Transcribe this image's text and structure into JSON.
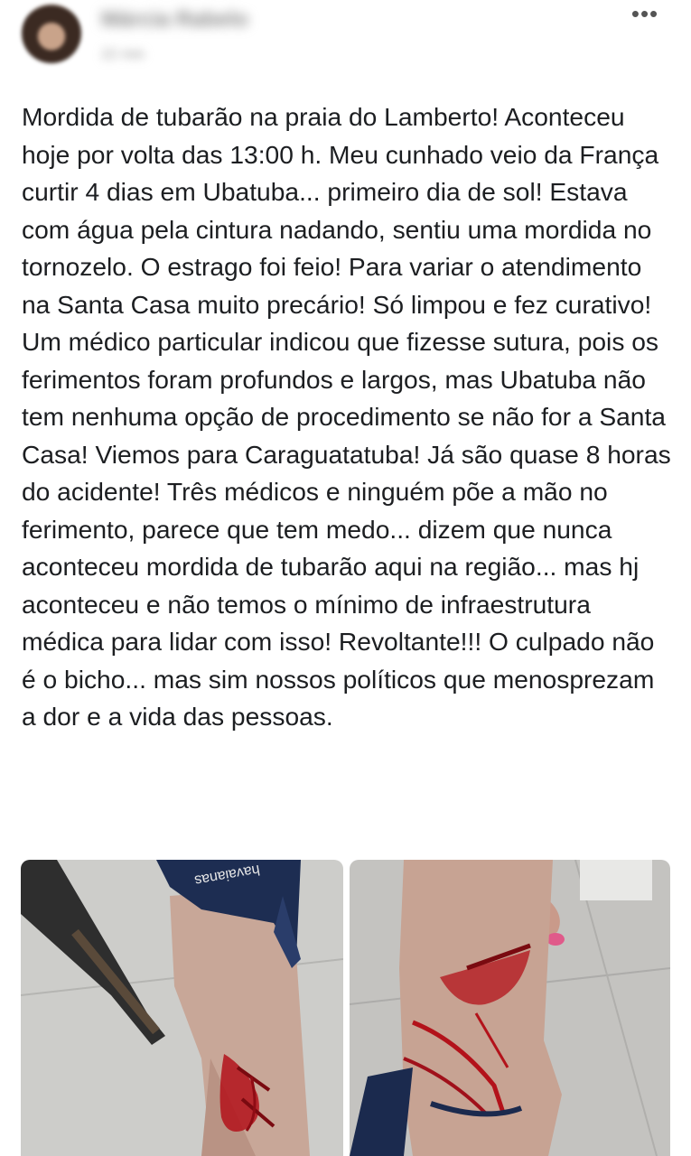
{
  "header": {
    "author_name": "Márcia Rabelo",
    "time": "22 min",
    "more_icon": "ellipsis-icon",
    "more_glyph": "•••"
  },
  "post": {
    "text": "Mordida de tubarão na praia do Lamberto! Aconteceu hoje por volta das 13:00 h. Meu cunhado veio da França curtir 4 dias em Ubatuba... primeiro dia de sol! Estava com água pela cintura nadando, sentiu uma mordida no tornozelo. O estrago foi feio! Para variar o atendimento na Santa Casa muito precário! Só limpou e fez curativo! Um médico particular indicou que fizesse sutura, pois os ferimentos foram profundos e largos, mas Ubatuba não tem nenhuma opção de procedimento se não for a Santa Casa! Viemos para Caraguatatuba! Já são quase 8 horas do acidente! Três médicos e ninguém põe a mão no ferimento, parece que tem medo... dizem que nunca aconteceu mordida de tubarão aqui na região... mas hj aconteceu e não temos o mínimo de infraestrutura médica para lidar com isso! Revoltante!!! O culpado não é o bicho... mas sim nossos políticos que menosprezam a dor e a vida das pessoas."
  },
  "photos": [
    {
      "sandal_brand": "havaianas"
    },
    {}
  ],
  "colors": {
    "text": "#1c1e21",
    "floor": "#cfcfcd",
    "skin": "#c9a89a",
    "blood": "#b3121a",
    "sandal": "#1d2d52"
  }
}
